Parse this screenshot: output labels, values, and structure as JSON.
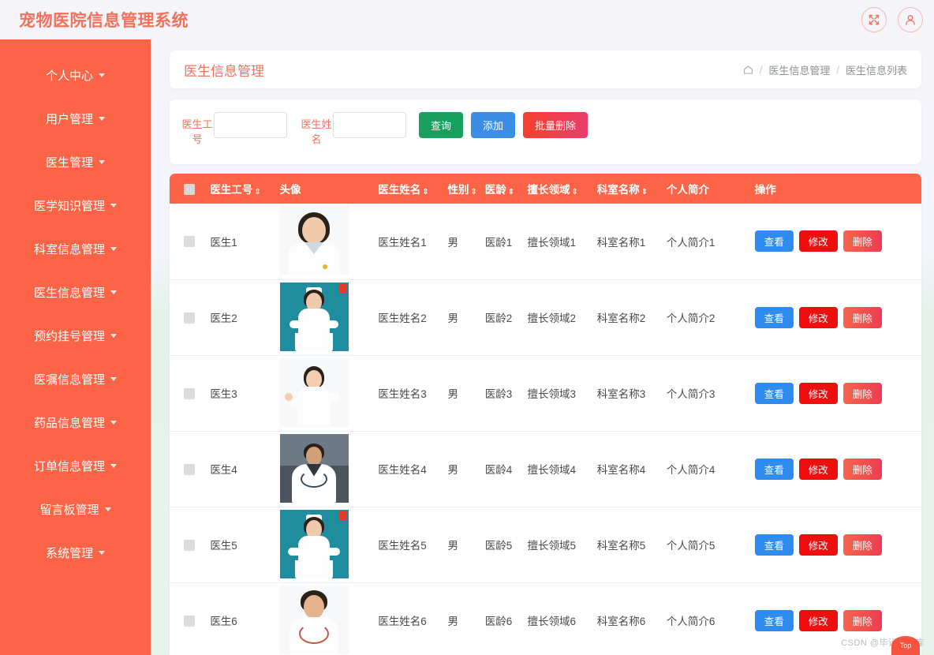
{
  "header": {
    "title": "宠物医院信息管理系统",
    "fullscreen_icon": "expand-arrows-icon",
    "user_icon": "user-icon"
  },
  "sidebar": {
    "items": [
      {
        "label": "个人中心"
      },
      {
        "label": "用户管理"
      },
      {
        "label": "医生管理"
      },
      {
        "label": "医学知识管理"
      },
      {
        "label": "科室信息管理"
      },
      {
        "label": "医生信息管理"
      },
      {
        "label": "预约挂号管理"
      },
      {
        "label": "医嘱信息管理"
      },
      {
        "label": "药品信息管理"
      },
      {
        "label": "订单信息管理"
      },
      {
        "label": "留言板管理"
      },
      {
        "label": "系统管理"
      }
    ]
  },
  "page": {
    "title": "医生信息管理",
    "breadcrumb": {
      "home_icon": "home-icon",
      "items": [
        "医生信息管理",
        "医生信息列表"
      ],
      "separator": "/"
    }
  },
  "search": {
    "fields": [
      {
        "label": "医生工号",
        "value": "",
        "placeholder": ""
      },
      {
        "label": "医生姓名",
        "value": "",
        "placeholder": ""
      }
    ],
    "buttons": {
      "query": "查询",
      "add": "添加",
      "batch_delete": "批量删除"
    }
  },
  "table": {
    "select_all_checkbox": "",
    "columns": [
      {
        "label": "医生工号",
        "sortable": true
      },
      {
        "label": "头像",
        "sortable": false
      },
      {
        "label": "医生姓名",
        "sortable": true
      },
      {
        "label": "性别",
        "sortable": true
      },
      {
        "label": "医龄",
        "sortable": true
      },
      {
        "label": "擅长领域",
        "sortable": true
      },
      {
        "label": "科室名称",
        "sortable": true
      },
      {
        "label": "个人简介",
        "sortable": false
      },
      {
        "label": "操作",
        "sortable": false
      }
    ],
    "sort_glyph": "⇕",
    "rows": [
      {
        "no": "医生1",
        "avatar": "doctor-female-portrait",
        "name": "医生姓名1",
        "sex": "男",
        "age": "医龄1",
        "field": "擅长领域1",
        "dept": "科室名称1",
        "intro": "个人简介1"
      },
      {
        "no": "医生2",
        "avatar": "nurse-teal-background",
        "name": "医生姓名2",
        "sex": "男",
        "age": "医龄2",
        "field": "擅长领域2",
        "dept": "科室名称2",
        "intro": "个人简介2"
      },
      {
        "no": "医生3",
        "avatar": "doctor-female-standing",
        "name": "医生姓名3",
        "sex": "男",
        "age": "医龄3",
        "field": "擅长领域3",
        "dept": "科室名称3",
        "intro": "个人简介3"
      },
      {
        "no": "医生4",
        "avatar": "doctor-male-office",
        "name": "医生姓名4",
        "sex": "男",
        "age": "医龄4",
        "field": "擅长领域4",
        "dept": "科室名称4",
        "intro": "个人简介4"
      },
      {
        "no": "医生5",
        "avatar": "nurse-teal-background",
        "name": "医生姓名5",
        "sex": "男",
        "age": "医龄5",
        "field": "擅长领域5",
        "dept": "科室名称5",
        "intro": "个人简介5"
      },
      {
        "no": "医生6",
        "avatar": "doctor-male-stethoscope",
        "name": "医生姓名6",
        "sex": "男",
        "age": "医龄6",
        "field": "擅长领域6",
        "dept": "科室名称6",
        "intro": "个人简介6"
      }
    ],
    "row_buttons": {
      "view": "查看",
      "edit": "修改",
      "delete": "删除"
    }
  },
  "watermark": {
    "text": "CSDN @毕设做码库",
    "top_button": "Top"
  },
  "colors": {
    "brand": "#fb6447",
    "title": "#f4705a",
    "query_button": "#19a05c",
    "add_button": "#3a8ee6",
    "batch_delete_button": "#f4402c",
    "view_button": "#2e8bef",
    "edit_button": "#f00d0d",
    "delete_button": "#ef3a52",
    "content_background": "#e8f2ec"
  }
}
